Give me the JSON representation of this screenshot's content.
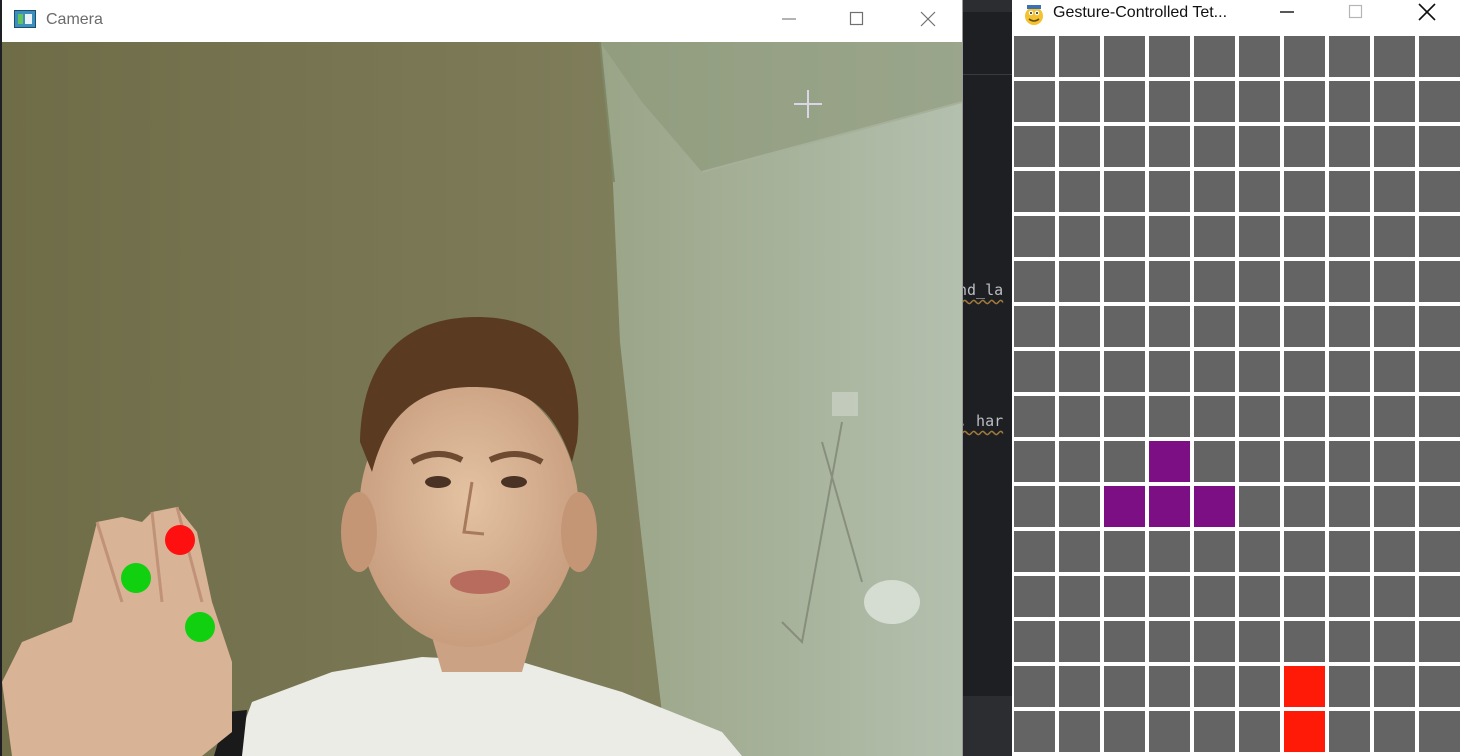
{
  "camera_window": {
    "title": "Camera",
    "icon": "camera-app-icon",
    "controls": [
      "minimize",
      "maximize",
      "close"
    ],
    "fingertip_markers": [
      {
        "color": "#ff1010",
        "name": "red-fingertip-marker"
      },
      {
        "color": "#10d010",
        "name": "green-fingertip-marker-1"
      },
      {
        "color": "#10d010",
        "name": "green-fingertip-marker-2"
      }
    ]
  },
  "tetris_window": {
    "title": "Gesture-Controlled Tet...",
    "icon": "pygame-snake-icon",
    "controls": [
      "minimize",
      "maximize",
      "close"
    ],
    "board": {
      "columns": 10,
      "visible_rows": 16,
      "empty_color": "#646464",
      "grid_line_color": "#ffffff",
      "active_piece": {
        "shape": "T",
        "color": "#7c0f84",
        "cells": [
          [
            3,
            9
          ],
          [
            2,
            10
          ],
          [
            3,
            10
          ],
          [
            4,
            10
          ]
        ]
      },
      "placed_blocks": [
        {
          "color": "#ff1a07",
          "cells": [
            [
              6,
              14
            ],
            [
              6,
              15
            ]
          ]
        }
      ]
    }
  },
  "background_editor": {
    "fragments": [
      "nd_la",
      ", har"
    ]
  },
  "colors": {
    "titlebar_bg": "#ffffff",
    "editor_bg": "#1e1f22"
  }
}
